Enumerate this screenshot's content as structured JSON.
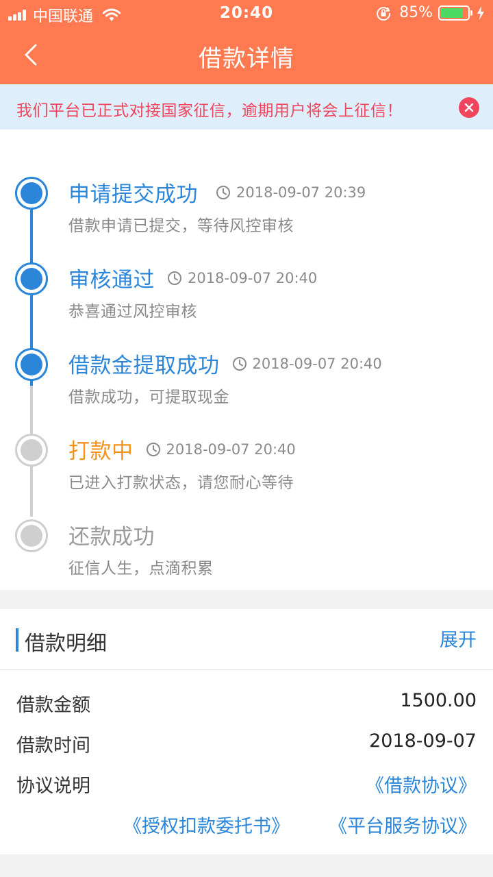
{
  "status_bar": {
    "carrier": "中国联通",
    "time": "20:40",
    "battery_percent": "85%",
    "battery_level": 0.85,
    "battery_color": "#4cd964"
  },
  "nav": {
    "title": "借款详情",
    "back_icon": "chevron-left-icon",
    "background": "#ff7a50"
  },
  "notice": {
    "text": "我们平台已正式对接国家征信，逾期用户将会上征信！",
    "close_icon": "close-icon"
  },
  "timeline": {
    "accent": "#2b86d9",
    "steps": [
      {
        "title": "申请提交成功",
        "time": "2018-09-07 20:39",
        "desc": "借款申请已提交，等待风控审核",
        "state": "done"
      },
      {
        "title": "审核通过",
        "time": "2018-09-07 20:40",
        "desc": "恭喜通过风控审核",
        "state": "done"
      },
      {
        "title": "借款金提取成功",
        "time": "2018-09-07 20:40",
        "desc": "借款成功，可提取现金",
        "state": "done"
      },
      {
        "title": "打款中",
        "time": "2018-09-07 20:40",
        "desc": "已进入打款状态，请您耐心等待",
        "state": "current"
      },
      {
        "title": "还款成功",
        "time": "",
        "desc": "征信人生，点滴积累",
        "state": "pending"
      }
    ]
  },
  "detail": {
    "title": "借款明细",
    "expand_label": "展开",
    "rows": [
      {
        "label": "借款金额",
        "value": "1500.00"
      },
      {
        "label": "借款时间",
        "value": "2018-09-07"
      },
      {
        "label": "协议说明",
        "value": ""
      }
    ],
    "links": {
      "loan_agreement": "《借款协议》",
      "authorization": "《授权扣款委托书》",
      "service_agreement": "《平台服务协议》"
    }
  }
}
